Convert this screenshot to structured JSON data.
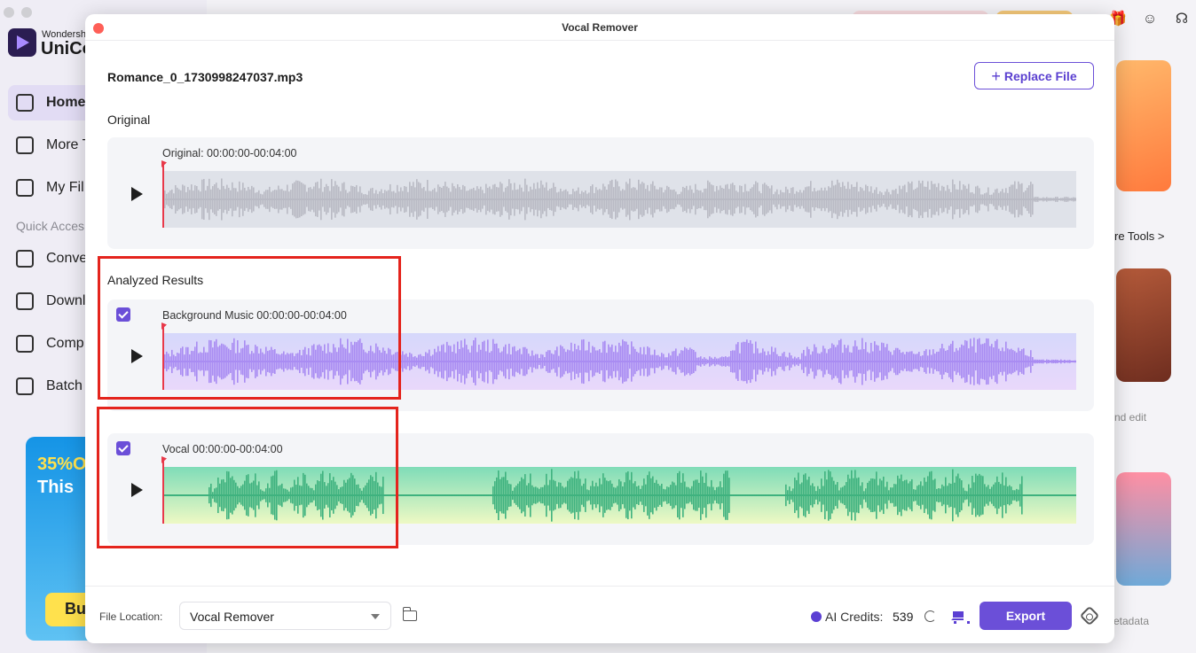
{
  "background": {
    "brand_small": "Wondersh",
    "brand": "UniCo",
    "nav": [
      "Home",
      "More T",
      "My Fil"
    ],
    "quick_access_label": "Quick Acces",
    "quick_items": [
      "Conve",
      "Downl",
      "Comp",
      "Batch"
    ],
    "promo_line1": "35%O",
    "promo_line2": "This",
    "promo_buy": "Bu",
    "more_tools": "re Tools >",
    "edit_text": "nd edit",
    "metadata_text": "etadata"
  },
  "dialog": {
    "title": "Vocal Remover",
    "file_name": "Romance_0_1730998247037.mp3",
    "replace_label": "Replace File",
    "original_section": "Original",
    "analyzed_section": "Analyzed Results",
    "tracks": {
      "original": {
        "label": "Original:  00:00:00-00:04:00",
        "color": "#b9bac4"
      },
      "music": {
        "label": "Background Music  00:00:00-00:04:00",
        "color": "#a98cf2",
        "checked": true
      },
      "vocal": {
        "label": "Vocal  00:00:00-00:04:00",
        "color": "#3fb27f",
        "checked": true
      }
    },
    "file_location_label": "File Location:",
    "file_location_value": "Vocal Remover",
    "ai_credits_label": "AI Credits:",
    "ai_credits_value": "539",
    "export_label": "Export",
    "accent_color": "#6b4fd8",
    "highlight_color": "#e4241d"
  }
}
